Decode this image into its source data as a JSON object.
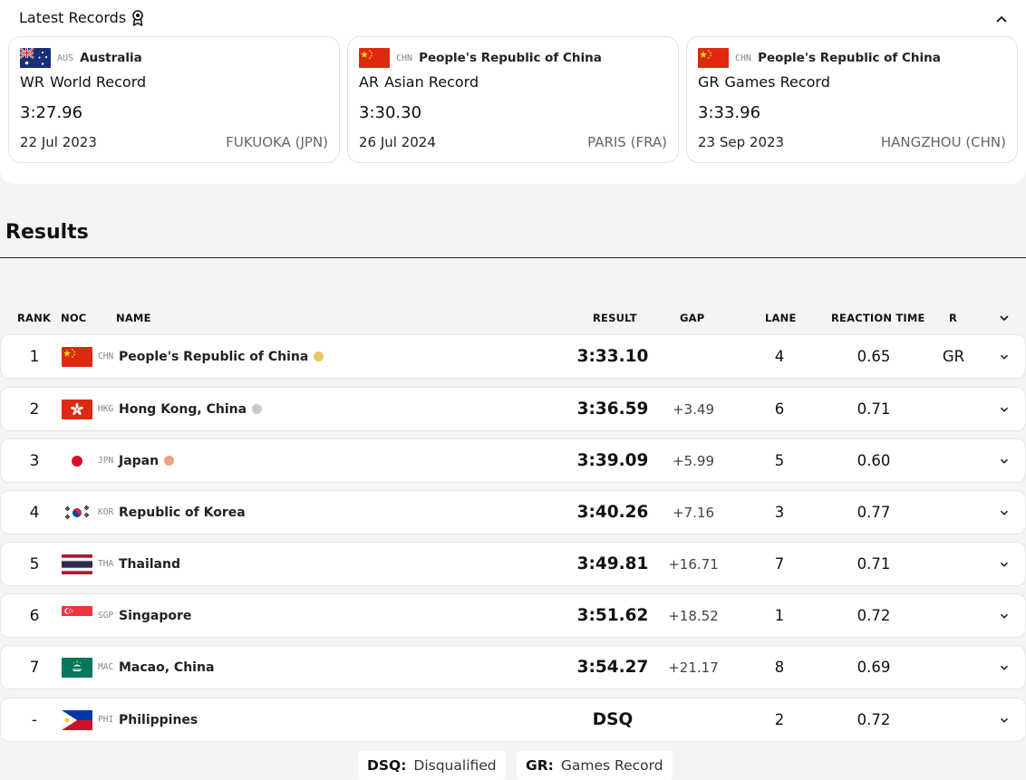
{
  "latest_records": {
    "title": "Latest Records",
    "cards": [
      {
        "code": "AUS",
        "country": "Australia",
        "abbr": "WR",
        "record_name": "World Record",
        "time": "3:27.96",
        "date": "22 Jul 2023",
        "venue": "FUKUOKA (JPN)"
      },
      {
        "code": "CHN",
        "country": "People's Republic of China",
        "abbr": "AR",
        "record_name": "Asian Record",
        "time": "3:30.30",
        "date": "26 Jul 2024",
        "venue": "PARIS (FRA)"
      },
      {
        "code": "CHN",
        "country": "People's Republic of China",
        "abbr": "GR",
        "record_name": "Games Record",
        "time": "3:33.96",
        "date": "23 Sep 2023",
        "venue": "HANGZHOU (CHN)"
      }
    ]
  },
  "results": {
    "title": "Results",
    "columns": {
      "rank": "RANK",
      "noc": "NOC",
      "name": "NAME",
      "result": "RESULT",
      "gap": "GAP",
      "lane": "LANE",
      "reaction": "REACTION TIME",
      "record": "R"
    },
    "rows": [
      {
        "rank": "1",
        "noc": "CHN",
        "name": "People's Republic of China",
        "medal": "gold",
        "result": "3:33.10",
        "gap": "",
        "lane": "4",
        "reaction": "0.65",
        "record": "GR"
      },
      {
        "rank": "2",
        "noc": "HKG",
        "name": "Hong Kong, China",
        "medal": "silver",
        "result": "3:36.59",
        "gap": "+3.49",
        "lane": "6",
        "reaction": "0.71",
        "record": ""
      },
      {
        "rank": "3",
        "noc": "JPN",
        "name": "Japan",
        "medal": "bronze",
        "result": "3:39.09",
        "gap": "+5.99",
        "lane": "5",
        "reaction": "0.60",
        "record": ""
      },
      {
        "rank": "4",
        "noc": "KOR",
        "name": "Republic of Korea",
        "medal": "",
        "result": "3:40.26",
        "gap": "+7.16",
        "lane": "3",
        "reaction": "0.77",
        "record": ""
      },
      {
        "rank": "5",
        "noc": "THA",
        "name": "Thailand",
        "medal": "",
        "result": "3:49.81",
        "gap": "+16.71",
        "lane": "7",
        "reaction": "0.71",
        "record": ""
      },
      {
        "rank": "6",
        "noc": "SGP",
        "name": "Singapore",
        "medal": "",
        "result": "3:51.62",
        "gap": "+18.52",
        "lane": "1",
        "reaction": "0.72",
        "record": ""
      },
      {
        "rank": "7",
        "noc": "MAC",
        "name": "Macao, China",
        "medal": "",
        "result": "3:54.27",
        "gap": "+21.17",
        "lane": "8",
        "reaction": "0.69",
        "record": ""
      },
      {
        "rank": "-",
        "noc": "PHI",
        "name": "Philippines",
        "medal": "",
        "result": "DSQ",
        "gap": "",
        "lane": "2",
        "reaction": "0.72",
        "record": ""
      }
    ]
  },
  "legend": [
    {
      "key": "DSQ:",
      "value": "Disqualified"
    },
    {
      "key": "GR:",
      "value": "Games Record"
    }
  ],
  "colors": {
    "gold": "#e7c766",
    "silver": "#c8c8c8",
    "bronze": "#e9a582"
  }
}
